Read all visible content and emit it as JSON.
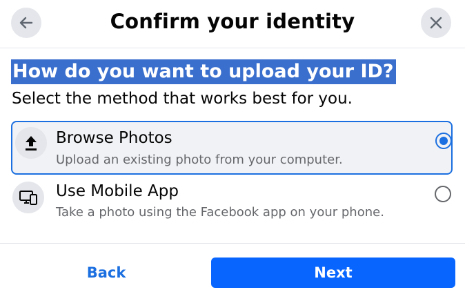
{
  "header": {
    "title": "Confirm your identity",
    "back_icon": "arrow-left-icon",
    "close_icon": "close-icon"
  },
  "content": {
    "question": "How do you want to upload your ID?",
    "subtitle": "Select the method that works best for you."
  },
  "options": [
    {
      "title": "Browse Photos",
      "description": "Upload an existing photo from your computer.",
      "icon": "upload-icon",
      "selected": true
    },
    {
      "title": "Use Mobile App",
      "description": "Take a photo using the Facebook app on your phone.",
      "icon": "devices-icon",
      "selected": false
    }
  ],
  "footer": {
    "back_label": "Back",
    "next_label": "Next"
  },
  "colors": {
    "accent": "#0866ff",
    "selection_highlight": "#3a6fcd",
    "secondary_text": "#65676b",
    "button_gray": "#e4e6eb"
  }
}
